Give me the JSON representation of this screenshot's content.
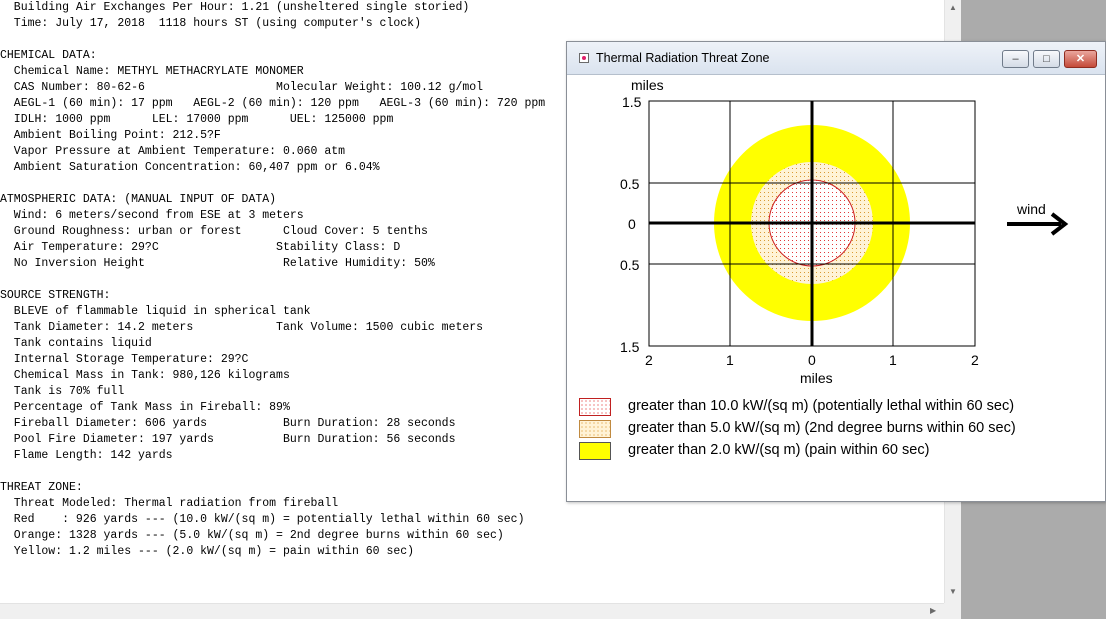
{
  "report": {
    "lines": [
      "  Building Air Exchanges Per Hour: 1.21 (unsheltered single storied)",
      "  Time: July 17, 2018  1118 hours ST (using computer's clock)",
      "",
      "CHEMICAL DATA:",
      "  Chemical Name: METHYL METHACRYLATE MONOMER",
      "  CAS Number: 80-62-6                   Molecular Weight: 100.12 g/mol",
      "  AEGL-1 (60 min): 17 ppm   AEGL-2 (60 min): 120 ppm   AEGL-3 (60 min): 720 ppm",
      "  IDLH: 1000 ppm      LEL: 17000 ppm      UEL: 125000 ppm",
      "  Ambient Boiling Point: 212.5?F",
      "  Vapor Pressure at Ambient Temperature: 0.060 atm",
      "  Ambient Saturation Concentration: 60,407 ppm or 6.04%",
      "",
      "ATMOSPHERIC DATA: (MANUAL INPUT OF DATA)",
      "  Wind: 6 meters/second from ESE at 3 meters",
      "  Ground Roughness: urban or forest      Cloud Cover: 5 tenths",
      "  Air Temperature: 29?C                 Stability Class: D",
      "  No Inversion Height                    Relative Humidity: 50%",
      "",
      "SOURCE STRENGTH:",
      "  BLEVE of flammable liquid in spherical tank",
      "  Tank Diameter: 14.2 meters            Tank Volume: 1500 cubic meters",
      "  Tank contains liquid",
      "  Internal Storage Temperature: 29?C",
      "  Chemical Mass in Tank: 980,126 kilograms",
      "  Tank is 70% full",
      "  Percentage of Tank Mass in Fireball: 89%",
      "  Fireball Diameter: 606 yards           Burn Duration: 28 seconds",
      "  Pool Fire Diameter: 197 yards          Burn Duration: 56 seconds",
      "  Flame Length: 142 yards",
      "",
      "THREAT ZONE:",
      "  Threat Modeled: Thermal radiation from fireball",
      "  Red    : 926 yards --- (10.0 kW/(sq m) = potentially lethal within 60 sec)",
      "  Orange: 1328 yards --- (5.0 kW/(sq m) = 2nd degree burns within 60 sec)",
      "  Yellow: 1.2 miles --- (2.0 kW/(sq m) = pain within 60 sec)"
    ]
  },
  "window": {
    "title": "Thermal Radiation Threat Zone",
    "min_icon": "minimize-icon",
    "max_icon": "maximize-icon",
    "close_icon": "close-icon"
  },
  "plot": {
    "y_unit_label": "miles",
    "x_unit_label": "miles",
    "y_ticks": [
      "1.5",
      "0.5",
      "0",
      "0.5",
      "1.5"
    ],
    "x_ticks": [
      "2",
      "1",
      "0",
      "1",
      "2"
    ],
    "wind_label": "wind",
    "zones": [
      {
        "name": "Yellow",
        "radius_miles": 1.2,
        "color": "#ffff00"
      },
      {
        "name": "Orange",
        "radius_miles": 0.75,
        "color": "#f5deb3"
      },
      {
        "name": "Red",
        "radius_miles": 0.53,
        "color": "#fde8e8"
      }
    ]
  },
  "legend": [
    {
      "label": "greater than 10.0 kW/(sq m) (potentially lethal within 60 sec)",
      "swatch": "red-dotted"
    },
    {
      "label": "greater than 5.0 kW/(sq m) (2nd degree burns within 60 sec)",
      "swatch": "orange-dotted"
    },
    {
      "label": "greater than 2.0 kW/(sq m) (pain within 60 sec)",
      "swatch": "yellow-solid"
    }
  ],
  "icons": {
    "window_icon": "app-icon",
    "wind_arrow": "arrow-right-icon",
    "scroll_up": "scroll-up-arrow-icon",
    "scroll_down": "scroll-down-arrow-icon",
    "scroll_right": "scroll-right-arrow-icon"
  }
}
